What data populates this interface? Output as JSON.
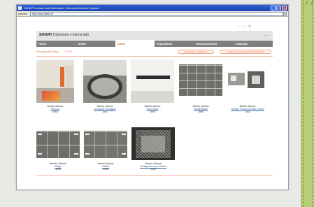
{
  "window": {
    "title": "SIKART Lexikon und Datenbank - Microsoft Internet Explorer",
    "address_label": "Adresse",
    "address_value": "http://www.sikart.ch",
    "go_label": "▾"
  },
  "page": {
    "brand_name": "SIKART",
    "brand_subtitle": "Dizionario e banca dati",
    "top_icons": "⌂ ? ▫ ⊡",
    "brand_tools": "+ − ▫",
    "nav": [
      {
        "label": "Home",
        "active": false
      },
      {
        "label": "Artisti",
        "active": false
      },
      {
        "label": "Opere",
        "active": true
      },
      {
        "label": "Esposizioni",
        "active": false
      },
      {
        "label": "Riconoscimenti",
        "active": false
      },
      {
        "label": "Cataloghi",
        "active": false
      }
    ],
    "breadcrumb": "Selezione del Artista …… 1 2 3 4",
    "button_list": "LISTA DELLE IMMAGINI",
    "button_back": "TORNA ALLA SCHEDA INFORMATIVA",
    "works": [
      {
        "artist": "Beretta, Adriana",
        "title": "Percorso",
        "year": "1992"
      },
      {
        "artist": "Beretta, Adriana",
        "title": "La ragione di Antigone",
        "year": "1992"
      },
      {
        "artist": "Beretta, Adriana",
        "title": "Senza titolo",
        "year": "1994"
      },
      {
        "artist": "Beretta, Adriana",
        "title": "Schotti strada",
        "year": "1996"
      },
      {
        "artist": "Beretta, Adriana",
        "title": "Sentieri, Pericolo del Mar (Offset)",
        "year": "2002"
      },
      {
        "artist": "Beretta, Adriana",
        "title": "Ablage",
        "year": "2003"
      },
      {
        "artist": "Beretta, Adriana",
        "title": "Collana",
        "year": "2005"
      },
      {
        "artist": "Beretta, Adriana",
        "title": "Configurazione provvisoria",
        "year": "2005"
      }
    ]
  },
  "corner_marks": "/ /",
  "colors": {
    "accent": "#e1642f",
    "nav_bg": "#7f7f7f",
    "background": "#b7cf78"
  }
}
